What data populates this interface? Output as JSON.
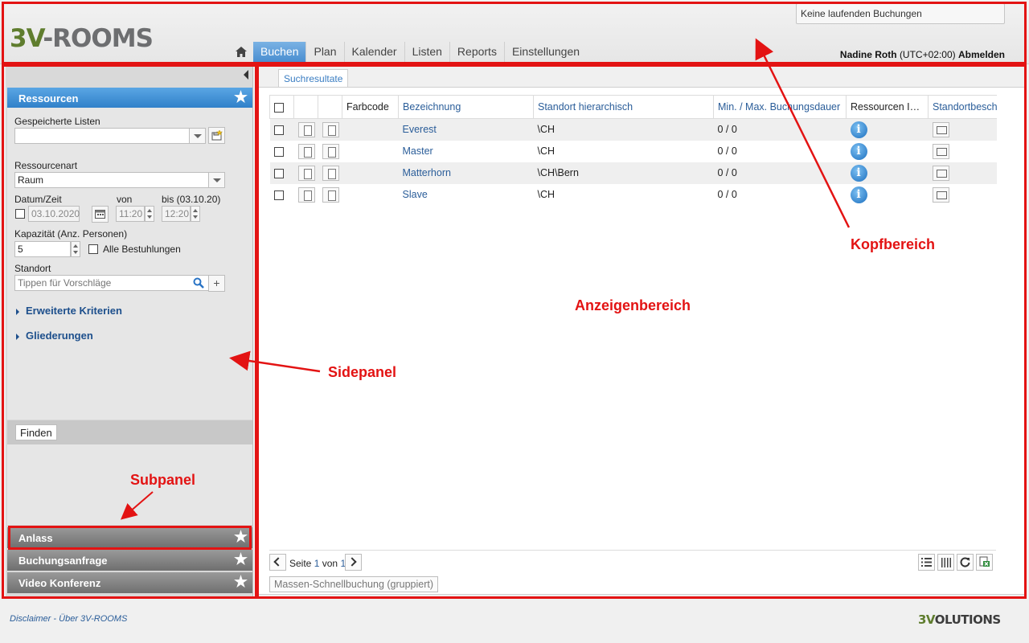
{
  "app": {
    "logo_prefix": "3V",
    "logo_text": "-ROOMS",
    "booking_status": "Keine laufenden Buchungen"
  },
  "nav": {
    "tabs": [
      {
        "label": "Buchen",
        "active": true
      },
      {
        "label": "Plan"
      },
      {
        "label": "Kalender"
      },
      {
        "label": "Listen"
      },
      {
        "label": "Reports"
      },
      {
        "label": "Einstellungen"
      }
    ]
  },
  "user": {
    "name": "Nadine Roth",
    "timezone": "(UTC+02:00)",
    "logout": "Abmelden"
  },
  "sidebar": {
    "resources_title": "Ressourcen",
    "saved_lists_label": "Gespeicherte Listen",
    "saved_lists_value": "",
    "resource_type_label": "Ressourcenart",
    "resource_type_value": "Raum",
    "datetime_label": "Datum/Zeit",
    "from_label": "von",
    "until_label": "bis (03.10.20)",
    "date_value": "03.10.2020",
    "from_value": "11:20",
    "until_value": "12:20",
    "capacity_label": "Kapazität (Anz. Personen)",
    "capacity_value": "5",
    "all_seating_label": "Alle Bestuhlungen",
    "location_label": "Standort",
    "location_placeholder": "Tippen für Vorschläge",
    "extended_criteria": "Erweiterte Kriterien",
    "structures": "Gliederungen",
    "find_button": "Finden",
    "subpanels": [
      {
        "label": "Anlass"
      },
      {
        "label": "Buchungsanfrage"
      },
      {
        "label": "Video Konferenz"
      }
    ]
  },
  "main": {
    "tab": "Suchresultate",
    "columns": [
      "Farbcode",
      "Bezeichnung",
      "Standort hierarchisch",
      "Min. / Max. Buchungsdauer",
      "Ressourcen Info",
      "Standortbeschreibung"
    ],
    "rows": [
      {
        "name": "Everest",
        "location": "\\CH",
        "duration": "0 / 0"
      },
      {
        "name": "Master",
        "location": "\\CH",
        "duration": "0 / 0"
      },
      {
        "name": "Matterhorn",
        "location": "\\CH\\Bern",
        "duration": "0 / 0"
      },
      {
        "name": "Slave",
        "location": "\\CH",
        "duration": "0 / 0"
      }
    ],
    "pager": {
      "page_label": "Seite",
      "current": "1",
      "of_label": "von",
      "total": "1"
    },
    "mass_booking": "Massen-Schnellbuchung (gruppiert)"
  },
  "annotations": {
    "header": "Kopfbereich",
    "display": "Anzeigenbereich",
    "sidepanel": "Sidepanel",
    "subpanel": "Subpanel",
    "color": "#e31313"
  },
  "footer": {
    "disclaimer": "Disclaimer",
    "separator": "-",
    "about": "Über 3V-ROOMS",
    "logo_prefix": "3V",
    "logo_text": "OLUTIONS"
  }
}
